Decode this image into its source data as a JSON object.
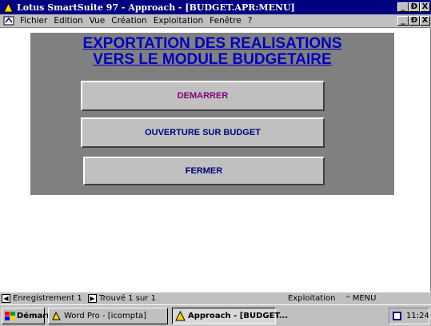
{
  "window": {
    "title": "Lotus SmartSuite 97   - Approach - [BUDGET.APR:MENU]",
    "minimize": "_",
    "restore": "Ɖ",
    "close": "X"
  },
  "menubar": {
    "items": [
      "Fichier",
      "Edition",
      "Vue",
      "Création",
      "Exploitation",
      "Fenêtre",
      "?"
    ],
    "doc_minimize": "_",
    "doc_restore": "Ɖ",
    "doc_close": "X"
  },
  "form": {
    "title_line1": "EXPORTATION DES REALISATIONS",
    "title_line2": "VERS LE MODULE BUDGETAIRE",
    "buttons": {
      "start": "DEMARRER",
      "open_budget": "OUVERTURE SUR BUDGET",
      "close": "FERMER"
    },
    "colors": {
      "title": "#0000c0",
      "start_label": "#800080",
      "other_labels": "#000080",
      "panel": "#808080"
    }
  },
  "statusbar": {
    "record": "Enregistrement 1",
    "found": "Trouvé 1 sur 1",
    "mode": "Exploitation",
    "view": "MENU"
  },
  "taskbar": {
    "start": "Démarrer",
    "task1": "Word Pro - [icompta]",
    "task2": "Approach - [BUDGET...",
    "clock": "11:24"
  }
}
